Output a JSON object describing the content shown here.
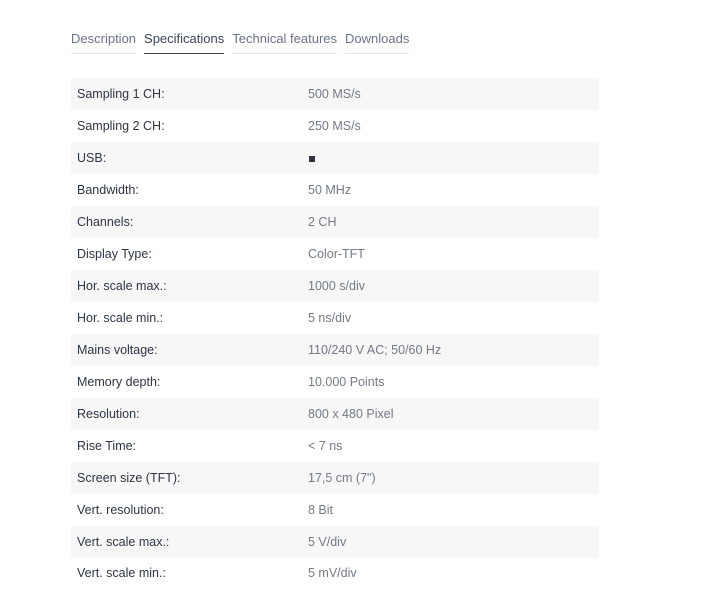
{
  "tabs": [
    {
      "label": "Description",
      "active": false
    },
    {
      "label": "Specifications",
      "active": true
    },
    {
      "label": "Technical features",
      "active": false
    },
    {
      "label": "Downloads",
      "active": false
    }
  ],
  "specs": [
    {
      "label": "Sampling 1 CH:",
      "value": "500 MS/s"
    },
    {
      "label": "Sampling 2 CH:",
      "value": "250 MS/s"
    },
    {
      "label": "USB:",
      "value": "",
      "icon": "filled-square-icon"
    },
    {
      "label": "Bandwidth:",
      "value": "50 MHz"
    },
    {
      "label": "Channels:",
      "value": "2 CH"
    },
    {
      "label": "Display Type:",
      "value": "Color-TFT"
    },
    {
      "label": "Hor. scale max.:",
      "value": "1000 s/div"
    },
    {
      "label": "Hor. scale min.:",
      "value": "5 ns/div"
    },
    {
      "label": "Mains voltage:",
      "value": "110/240 V AC; 50/60 Hz"
    },
    {
      "label": "Memory depth:",
      "value": "10.000 Points"
    },
    {
      "label": "Resolution:",
      "value": "800 x 480 Pixel"
    },
    {
      "label": "Rise Time:",
      "value": "< 7 ns"
    },
    {
      "label": "Screen size (TFT):",
      "value": "17,5 cm (7\")"
    },
    {
      "label": "Vert. resolution:",
      "value": "8 Bit"
    },
    {
      "label": "Vert. scale max.:",
      "value": "5 V/div"
    },
    {
      "label": "Vert. scale min.:",
      "value": "5 mV/div"
    }
  ],
  "colors": {
    "row_stripe": "#f7f7f7",
    "label_text": "#2d3442",
    "value_text": "#737a86",
    "tab_text": "#6b7384",
    "tab_active": "#3c4556"
  }
}
